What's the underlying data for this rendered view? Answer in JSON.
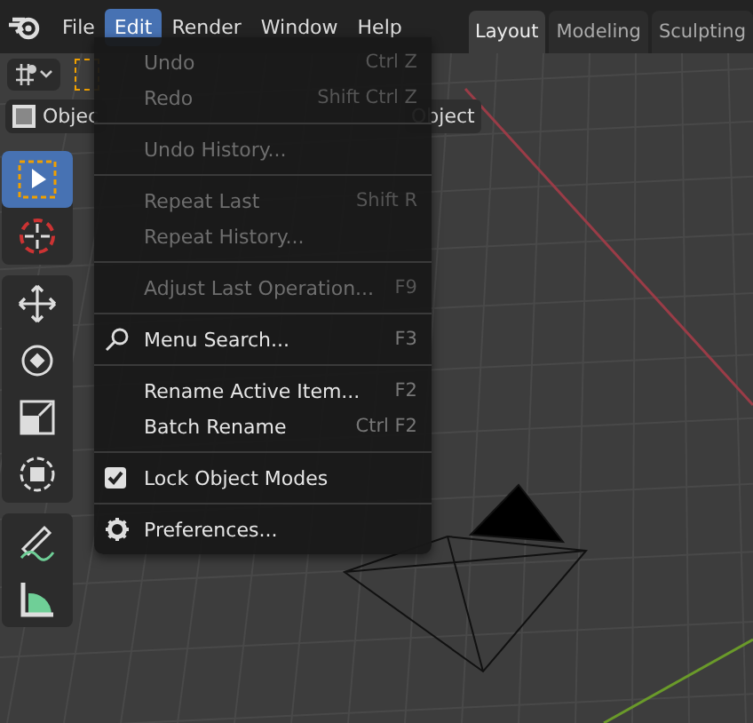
{
  "menubar": {
    "items": [
      {
        "label": "File",
        "selected": false
      },
      {
        "label": "Edit",
        "selected": true
      },
      {
        "label": "Render",
        "selected": false
      },
      {
        "label": "Window",
        "selected": false
      },
      {
        "label": "Help",
        "selected": false
      }
    ]
  },
  "workspace_tabs": [
    {
      "label": "Layout",
      "selected": true
    },
    {
      "label": "Modeling",
      "selected": false
    },
    {
      "label": "Sculpting",
      "selected": false
    }
  ],
  "header": {
    "mode_button": "Objec",
    "object_menu": "Object"
  },
  "toolbar": {
    "groups": [
      [
        {
          "kind": "select",
          "selected": true
        },
        {
          "kind": "cursor",
          "selected": false
        }
      ],
      [
        {
          "kind": "move",
          "selected": false
        },
        {
          "kind": "rotate",
          "selected": false
        },
        {
          "kind": "scale",
          "selected": false
        },
        {
          "kind": "transform",
          "selected": false
        }
      ],
      [
        {
          "kind": "annotate",
          "selected": false
        },
        {
          "kind": "measure",
          "selected": false
        }
      ]
    ]
  },
  "edit_menu": {
    "groups": [
      [
        {
          "kind": "plain",
          "label": "Undo",
          "shortcut": "Ctrl Z",
          "disabled": true
        },
        {
          "kind": "plain",
          "label": "Redo",
          "shortcut": "Shift Ctrl Z",
          "disabled": true
        }
      ],
      [
        {
          "kind": "plain",
          "label": "Undo History...",
          "disabled": true
        }
      ],
      [
        {
          "kind": "plain",
          "label": "Repeat Last",
          "shortcut": "Shift R",
          "disabled": true
        },
        {
          "kind": "plain",
          "label": "Repeat History...",
          "disabled": true
        }
      ],
      [
        {
          "kind": "plain",
          "label": "Adjust Last Operation...",
          "shortcut": "F9",
          "disabled": true
        }
      ],
      [
        {
          "kind": "search",
          "label": "Menu Search...",
          "shortcut": "F3",
          "disabled": false
        }
      ],
      [
        {
          "kind": "plain",
          "label": "Rename Active Item...",
          "shortcut": "F2",
          "disabled": false
        },
        {
          "kind": "plain",
          "label": "Batch Rename",
          "shortcut": "Ctrl F2",
          "disabled": false
        }
      ],
      [
        {
          "kind": "checkbox",
          "label": "Lock Object Modes",
          "checked": true,
          "disabled": false
        }
      ],
      [
        {
          "kind": "gear",
          "label": "Preferences...",
          "disabled": false
        }
      ]
    ]
  }
}
